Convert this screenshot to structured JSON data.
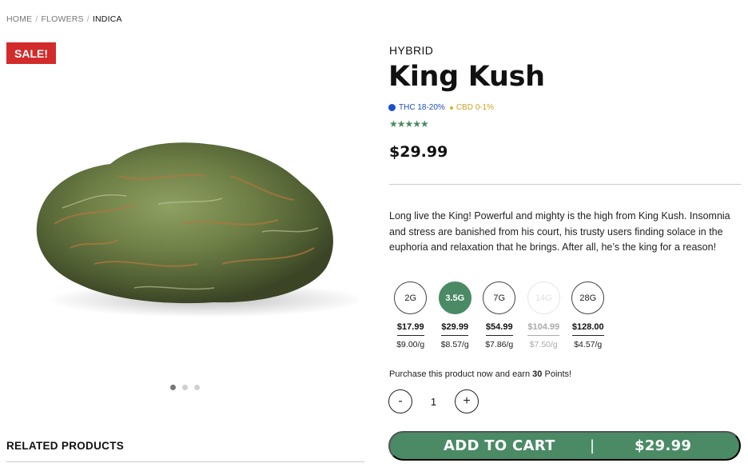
{
  "breadcrumb": {
    "home": "HOME",
    "flowers": "FLOWERS",
    "current": "INDICA",
    "separator": "/"
  },
  "badge": {
    "sale": "SALE!"
  },
  "product": {
    "strain_type": "HYBRID",
    "title": "King Kush",
    "thc": "THC 18-20%",
    "cbd": "CBD 0-1%",
    "rating_stars": 5,
    "stars": "★★★★★",
    "price": "$29.99",
    "description": "Long live the King! Powerful and mighty is the high from King Kush. Insomnia and stress are banished from his court, his trusty users finding solace in the euphoria and relaxation that he brings. After all, he’s the king for a reason!"
  },
  "weights": [
    {
      "label": "2G",
      "price": "$17.99",
      "per_gram": "$9.00/g",
      "state": "normal"
    },
    {
      "label": "3.5G",
      "price": "$29.99",
      "per_gram": "$8.57/g",
      "state": "selected"
    },
    {
      "label": "7G",
      "price": "$54.99",
      "per_gram": "$7.86/g",
      "state": "normal"
    },
    {
      "label": "14G",
      "price": "$104.99",
      "per_gram": "$7.50/g",
      "state": "disabled"
    },
    {
      "label": "28G",
      "price": "$128.00",
      "per_gram": "$4.57/g",
      "state": "normal"
    }
  ],
  "points": {
    "prefix": "Purchase this product now and earn",
    "value": "30",
    "suffix": "Points!"
  },
  "quantity": {
    "minus": "-",
    "value": "1",
    "plus": "+"
  },
  "cart": {
    "label": "ADD TO CART",
    "separator": "|",
    "price": "$29.99"
  },
  "related": {
    "title": "RELATED PRODUCTS"
  },
  "carousel": {
    "count": 3,
    "active_index": 0
  },
  "colors": {
    "accent": "#4a8a65",
    "sale": "#d22b2b",
    "thc": "#1f4fd0",
    "cbd": "#d6b42e"
  }
}
